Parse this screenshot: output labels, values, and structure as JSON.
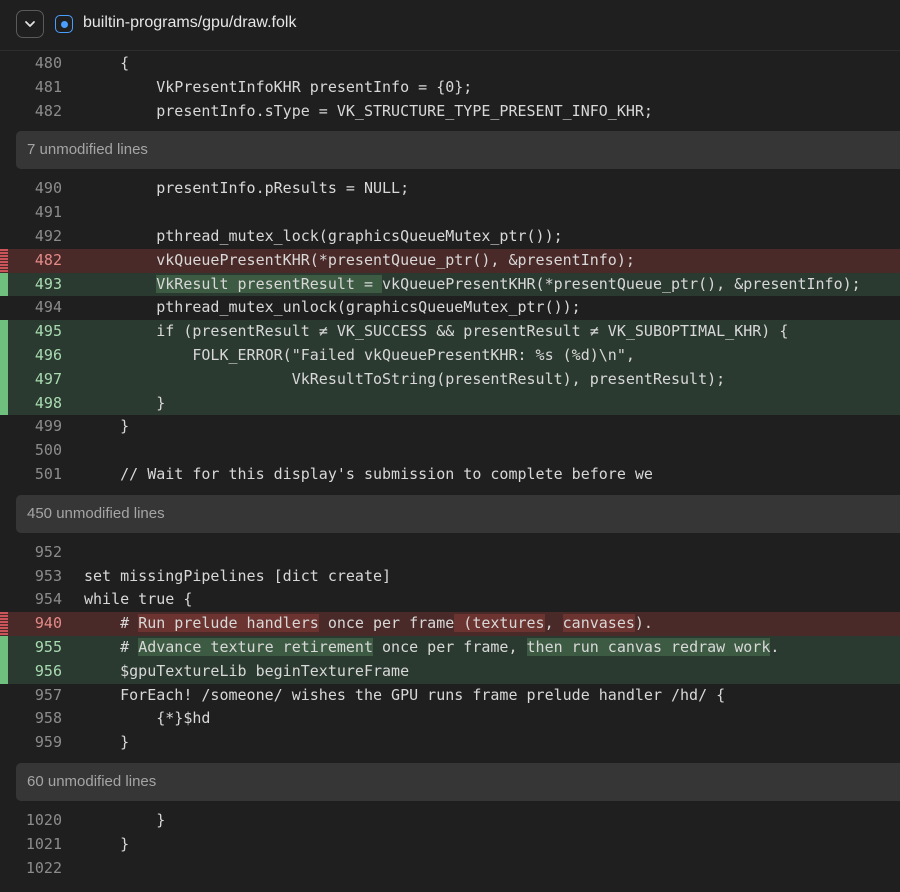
{
  "header": {
    "file_path": "builtin-programs/gpu/draw.folk"
  },
  "hunks": [
    {
      "type": "lines",
      "rows": [
        {
          "n": "480",
          "kind": "ctx",
          "segs": [
            {
              "t": "    {"
            }
          ]
        },
        {
          "n": "481",
          "kind": "ctx",
          "segs": [
            {
              "t": "        VkPresentInfoKHR presentInfo = {0};"
            }
          ]
        },
        {
          "n": "482",
          "kind": "ctx",
          "segs": [
            {
              "t": "        presentInfo.sType = VK_STRUCTURE_TYPE_PRESENT_INFO_KHR;"
            }
          ]
        }
      ]
    },
    {
      "type": "fold",
      "label": "7 unmodified lines"
    },
    {
      "type": "lines",
      "rows": [
        {
          "n": "490",
          "kind": "ctx",
          "segs": [
            {
              "t": "        presentInfo.pResults = NULL;"
            }
          ]
        },
        {
          "n": "491",
          "kind": "ctx",
          "segs": [
            {
              "t": ""
            }
          ]
        },
        {
          "n": "492",
          "kind": "ctx",
          "segs": [
            {
              "t": "        pthread_mutex_lock(graphicsQueueMutex_ptr());"
            }
          ]
        },
        {
          "n": "482",
          "kind": "del",
          "segs": [
            {
              "t": "        vkQueuePresentKHR(*presentQueue_ptr(), &presentInfo);"
            }
          ]
        },
        {
          "n": "493",
          "kind": "add",
          "segs": [
            {
              "t": "        "
            },
            {
              "t": "VkResult presentResult = ",
              "h": true
            },
            {
              "t": "vkQueuePresentKHR(*presentQueue_ptr(), &presentInfo);"
            }
          ]
        },
        {
          "n": "494",
          "kind": "ctx",
          "segs": [
            {
              "t": "        pthread_mutex_unlock(graphicsQueueMutex_ptr());"
            }
          ]
        },
        {
          "n": "495",
          "kind": "add",
          "segs": [
            {
              "t": "        if (presentResult ≠ VK_SUCCESS && presentResult ≠ VK_SUBOPTIMAL_KHR) {"
            }
          ]
        },
        {
          "n": "496",
          "kind": "add",
          "segs": [
            {
              "t": "            FOLK_ERROR(\"Failed vkQueuePresentKHR: %s (%d)\\n\","
            }
          ]
        },
        {
          "n": "497",
          "kind": "add",
          "segs": [
            {
              "t": "                       VkResultToString(presentResult), presentResult);"
            }
          ]
        },
        {
          "n": "498",
          "kind": "add",
          "segs": [
            {
              "t": "        }"
            }
          ]
        },
        {
          "n": "499",
          "kind": "ctx",
          "segs": [
            {
              "t": "    }"
            }
          ]
        },
        {
          "n": "500",
          "kind": "ctx",
          "segs": [
            {
              "t": ""
            }
          ]
        },
        {
          "n": "501",
          "kind": "ctx",
          "segs": [
            {
              "t": "    // Wait for this display's submission to complete before we"
            }
          ]
        }
      ]
    },
    {
      "type": "fold",
      "label": "450 unmodified lines"
    },
    {
      "type": "lines",
      "rows": [
        {
          "n": "952",
          "kind": "ctx",
          "segs": [
            {
              "t": ""
            }
          ]
        },
        {
          "n": "953",
          "kind": "ctx",
          "segs": [
            {
              "t": "set missingPipelines [dict create]"
            }
          ]
        },
        {
          "n": "954",
          "kind": "ctx",
          "segs": [
            {
              "t": "while true {"
            }
          ]
        },
        {
          "n": "940",
          "kind": "del",
          "segs": [
            {
              "t": "    # "
            },
            {
              "t": "Run prelude handlers",
              "h": true
            },
            {
              "t": " once per frame"
            },
            {
              "t": " (textures",
              "h": true
            },
            {
              "t": ", "
            },
            {
              "t": "canvases",
              "h": true
            },
            {
              "t": ")."
            }
          ]
        },
        {
          "n": "955",
          "kind": "add",
          "segs": [
            {
              "t": "    # "
            },
            {
              "t": "Advance texture retirement",
              "h": true
            },
            {
              "t": " once per frame, "
            },
            {
              "t": "then run canvas redraw work",
              "h": true
            },
            {
              "t": "."
            }
          ]
        },
        {
          "n": "956",
          "kind": "add",
          "segs": [
            {
              "t": "    $gpuTextureLib beginTextureFrame"
            }
          ]
        },
        {
          "n": "957",
          "kind": "ctx",
          "segs": [
            {
              "t": "    ForEach! /someone/ wishes the GPU runs frame prelude handler /hd/ {"
            }
          ]
        },
        {
          "n": "958",
          "kind": "ctx",
          "segs": [
            {
              "t": "        {*}$hd"
            }
          ]
        },
        {
          "n": "959",
          "kind": "ctx",
          "segs": [
            {
              "t": "    }"
            }
          ]
        }
      ]
    },
    {
      "type": "fold",
      "label": "60 unmodified lines"
    },
    {
      "type": "lines",
      "rows": [
        {
          "n": "1020",
          "kind": "ctx",
          "segs": [
            {
              "t": "        }"
            }
          ]
        },
        {
          "n": "1021",
          "kind": "ctx",
          "segs": [
            {
              "t": "    }"
            }
          ]
        },
        {
          "n": "1022",
          "kind": "ctx",
          "segs": [
            {
              "t": ""
            }
          ]
        }
      ]
    }
  ]
}
